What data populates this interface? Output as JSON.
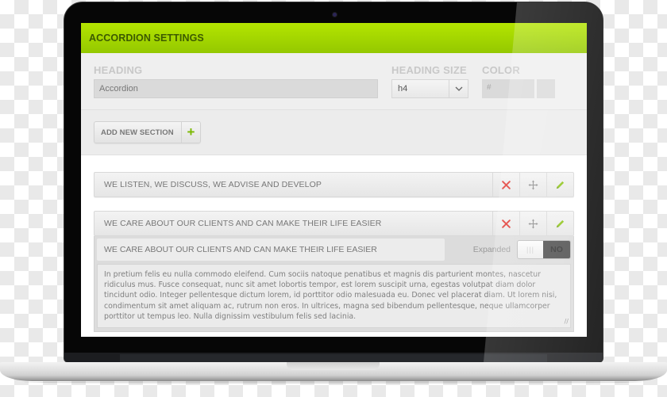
{
  "panel": {
    "title": "ACCORDION SETTINGS",
    "accent_color": "#a3d600"
  },
  "settings": {
    "heading_label": "HEADING",
    "heading_value": "Accordion",
    "heading_size_label": "HEADING SIZE",
    "heading_size_value": "h4",
    "color_label": "COLOR",
    "color_placeholder": "#"
  },
  "add_section": {
    "label": "ADD NEW SECTION",
    "icon": "plus-icon"
  },
  "sections": [
    {
      "title": "WE LISTEN, WE DISCUSS, WE ADVISE AND DEVELOP",
      "actions": [
        "delete-icon",
        "move-icon",
        "edit-icon"
      ]
    },
    {
      "title": "WE CARE ABOUT OUR CLIENTS AND CAN MAKE THEIR LIFE EASIER",
      "actions": [
        "delete-icon",
        "move-icon",
        "edit-icon"
      ],
      "expanded_editor": {
        "title_value": "WE CARE ABOUT OUR CLIENTS AND CAN MAKE THEIR LIFE EASIER",
        "expanded_label": "Expanded",
        "expanded_state": "NO",
        "body_text": "In pretium felis eu nulla commodo eleifend. Cum sociis natoque penatibus et magnis dis parturient montes, nascetur ridiculus mus. Fusce consequat, nunc sit amet lobortis tempor, est lorem suscipit urna, egestas volutpat diam dolor tincidunt odio. Integer pellentesque dictum lorem, id porttitor odio malesuada eu. Donec vel placerat diam. Ut lorem nisi, condimentum sit amet aliquam ac, rutrum non eros. In ultrices, magna sed bibendum pellentesque, neque ullamcorper porttitor ut tempus leo. Nulla dignissim vestibulum felis sed lacinia."
      }
    }
  ],
  "icon_colors": {
    "delete": "#e0302a",
    "move": "#8a8a8a",
    "edit": "#8cc314"
  }
}
